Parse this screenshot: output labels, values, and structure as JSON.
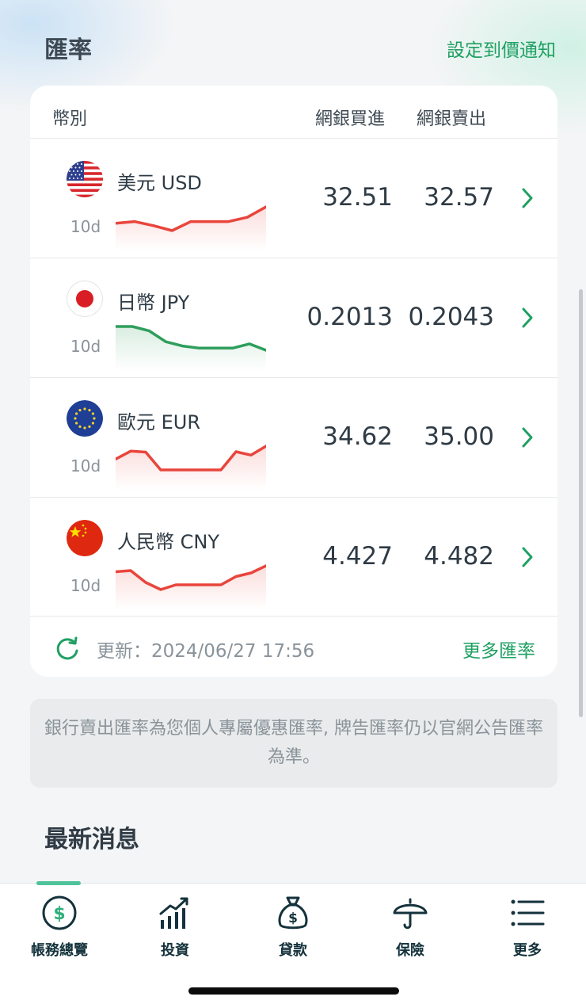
{
  "header": {
    "title": "匯率",
    "alert_link": "設定到價通知"
  },
  "table": {
    "col_currency": "幣別",
    "col_buy": "網銀買進",
    "col_sell": "網銀賣出"
  },
  "rates": [
    {
      "name": "美元 USD",
      "period": "10d",
      "buy": "32.51",
      "sell": "32.57",
      "flag": "us-flag",
      "trend": [
        0.31,
        0.38,
        0.21,
        0.0,
        0.38,
        0.38,
        0.38,
        0.56,
        1.0
      ]
    },
    {
      "name": "日幣 JPY",
      "period": "10d",
      "buy": "0.2013",
      "sell": "0.2043",
      "flag": "jp-flag",
      "trend": [
        1.0,
        1.0,
        0.82,
        0.36,
        0.18,
        0.09,
        0.09,
        0.09,
        0.27,
        0.0
      ]
    },
    {
      "name": "歐元 EUR",
      "period": "10d",
      "buy": "34.62",
      "sell": "35.00",
      "flag": "eu-flag",
      "trend": [
        0.55,
        0.95,
        0.9,
        0.0,
        0.0,
        0.0,
        0.0,
        0.0,
        0.92,
        0.75,
        1.2
      ]
    },
    {
      "name": "人民幣 CNY",
      "period": "10d",
      "buy": "4.427",
      "sell": "4.482",
      "flag": "cn-flag",
      "trend": [
        0.75,
        0.8,
        0.3,
        0.0,
        0.2,
        0.2,
        0.2,
        0.2,
        0.55,
        0.7,
        1.0
      ]
    }
  ],
  "update": {
    "text": "更新：2024/06/27 17:56",
    "more_link": "更多匯率"
  },
  "notice": "銀行賣出匯率為您個人專屬優惠匯率, 牌告匯率仍以官網公告匯率為準。",
  "news": {
    "title": "最新消息"
  },
  "tabbar": {
    "items": [
      {
        "label": "帳務總覽",
        "icon": "dollar-circle-icon",
        "active": true
      },
      {
        "label": "投資",
        "icon": "chart-up-icon",
        "active": false
      },
      {
        "label": "貸款",
        "icon": "money-bag-icon",
        "active": false
      },
      {
        "label": "保險",
        "icon": "umbrella-icon",
        "active": false
      },
      {
        "label": "更多",
        "icon": "menu-list-icon",
        "active": false
      }
    ]
  },
  "colors": {
    "accent": "#1fa063",
    "down_trend": "#2e9e5b",
    "up_trend": "#e8453c",
    "text_dark": "#2f3b45",
    "text_muted": "#8a939a"
  }
}
